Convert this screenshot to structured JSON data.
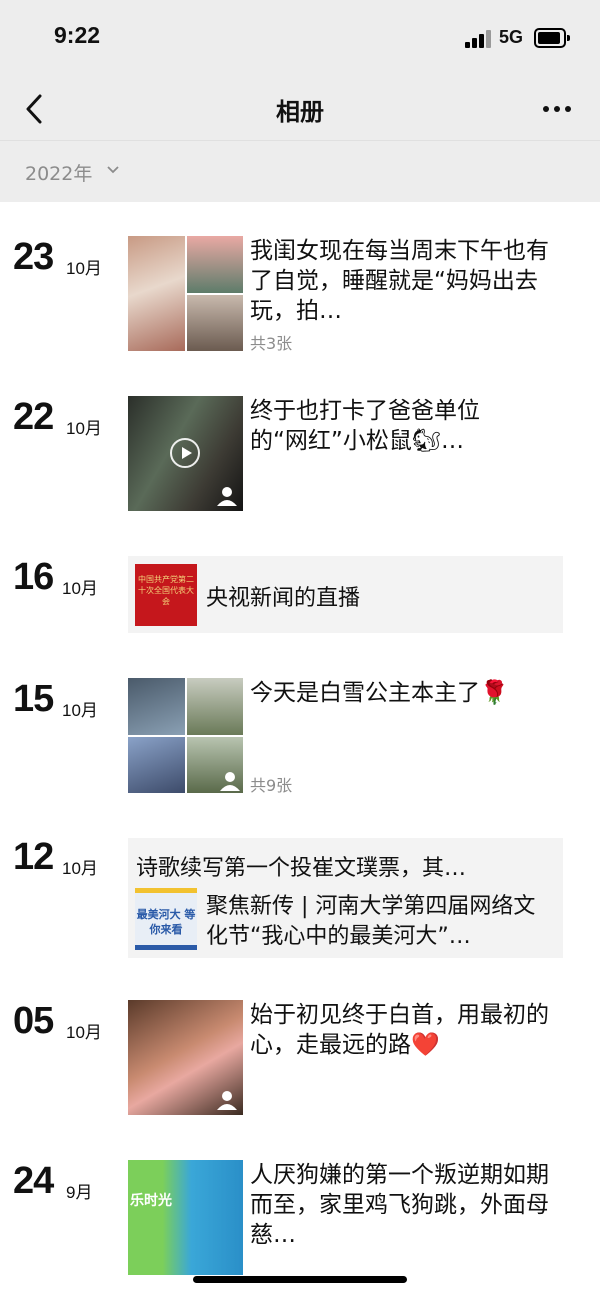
{
  "status_bar": {
    "time": "9:22",
    "network": "5G"
  },
  "nav": {
    "title": "相册"
  },
  "filter": {
    "year": "2022年"
  },
  "entries": [
    {
      "day": "23",
      "month": "10月",
      "caption": "我闺女现在每当周末下午也有了自觉，睡醒就是“妈妈出去玩，拍…",
      "count": "共3张"
    },
    {
      "day": "22",
      "month": "10月",
      "caption": "终于也打卡了爸爸单位的“网红”小松鼠🐿…"
    },
    {
      "day": "16",
      "month": "10月",
      "share_title": "央视新闻的直播",
      "thumb_text": "中国共产党第二十次全国代表大会"
    },
    {
      "day": "15",
      "month": "10月",
      "caption": "今天是白雪公主本主了🌹",
      "count": "共9张"
    },
    {
      "day": "12",
      "month": "10月",
      "text": "诗歌续写第一个投崔文璞票，其…",
      "share_title": "聚焦新传 | 河南大学第四届网络文化节“我心中的最美河大”…",
      "thumb_text": "最美河大 等你来看"
    },
    {
      "day": "05",
      "month": "10月",
      "caption": "始于初见终于白首，用最初的心，走最远的路❤️"
    },
    {
      "day": "24",
      "month": "9月",
      "caption": "人厌狗嫌的第一个叛逆期如期而至，家里鸡飞狗跳，外面母慈…",
      "thumb_text": "乐时光"
    }
  ],
  "colors": {
    "header_bg": "#ededed",
    "secondary_text": "#8c8c8c",
    "share_bg": "#f3f3f3"
  }
}
